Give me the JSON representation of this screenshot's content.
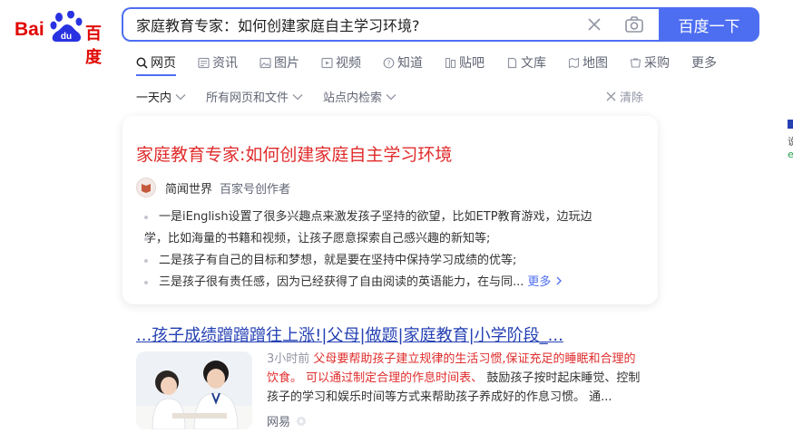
{
  "logo": {
    "latin": "Bai",
    "paw_text": "du",
    "chinese": "百度"
  },
  "search": {
    "query": "家庭教育专家：如何创建家庭自主学习环境?",
    "button_label": "百度一下"
  },
  "tabs": [
    {
      "label": "网页",
      "icon": "search-icon",
      "active": true
    },
    {
      "label": "资讯",
      "icon": "news-icon"
    },
    {
      "label": "图片",
      "icon": "image-icon"
    },
    {
      "label": "视频",
      "icon": "video-icon"
    },
    {
      "label": "知道",
      "icon": "question-icon"
    },
    {
      "label": "贴吧",
      "icon": "tieba-icon"
    },
    {
      "label": "文库",
      "icon": "doc-icon"
    },
    {
      "label": "地图",
      "icon": "map-icon"
    },
    {
      "label": "采购",
      "icon": "cart-icon"
    },
    {
      "label": "更多"
    }
  ],
  "filters": {
    "time": "一天内",
    "filetype": "所有网页和文件",
    "site": "站点内检索",
    "clear": "清除"
  },
  "result1": {
    "title": "家庭教育专家:如何创建家庭自主学习环境",
    "source_name": "简闻世界",
    "source_tag": "百家号创作者",
    "bullets": [
      "一是iEnglish设置了很多兴趣点来激发孩子坚持的欲望，比如ETP教育游戏，边玩边",
      "学，比如海量的书籍和视频，让孩子愿意探索自己感兴趣的新知等;",
      "二是孩子有自己的目标和梦想，就是要在坚持中保持学习成绩的优等;",
      "三是孩子很有责任感，因为已经获得了自由阅读的英语能力，在与同..."
    ],
    "more": "更多"
  },
  "result2": {
    "title": "...孩子成绩蹭蹭蹭往上涨!|父母|做题|家庭教育|小学阶段_...",
    "time": "3小时前",
    "line1_red": "父母要帮助孩子建立规律的生活习惯,保证充足的睡眠和合理的",
    "line2_red_a": "饮食。",
    "line2_red_b": "可以通过制定合理的作息时间表、",
    "line2_rest": "鼓励孩子按时起床睡觉、控制",
    "line3": "孩子的学习和娱乐时间等方式来帮助孩子养成好的作息习惯。 通...",
    "source": "网易"
  },
  "right_edge": {
    "t": "说",
    "g": "e"
  },
  "colors": {
    "brand_blue": "#4e6ef2",
    "title_red": "#e02c2c",
    "link_blue": "#2440b3"
  }
}
